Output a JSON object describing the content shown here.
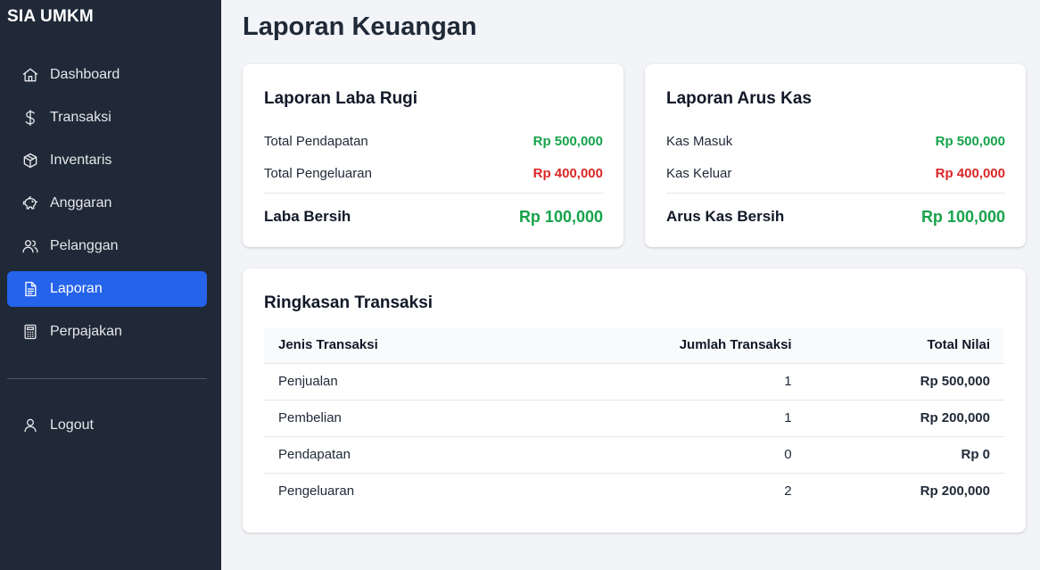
{
  "app": {
    "brand": "SIA UMKM"
  },
  "sidebar": {
    "items": [
      {
        "label": "Dashboard",
        "icon": "home-icon"
      },
      {
        "label": "Transaksi",
        "icon": "dollar-icon"
      },
      {
        "label": "Inventaris",
        "icon": "box-icon"
      },
      {
        "label": "Anggaran",
        "icon": "piggy-bank-icon"
      },
      {
        "label": "Pelanggan",
        "icon": "users-icon"
      },
      {
        "label": "Laporan",
        "icon": "document-icon",
        "active": true
      },
      {
        "label": "Perpajakan",
        "icon": "calculator-icon"
      }
    ],
    "logout": {
      "label": "Logout",
      "icon": "user-icon"
    }
  },
  "page": {
    "title": "Laporan Keuangan"
  },
  "profit_loss": {
    "title": "Laporan Laba Rugi",
    "income_label": "Total Pendapatan",
    "income_value": "Rp 500,000",
    "expense_label": "Total Pengeluaran",
    "expense_value": "Rp 400,000",
    "net_label": "Laba Bersih",
    "net_value": "Rp 100,000"
  },
  "cash_flow": {
    "title": "Laporan Arus Kas",
    "in_label": "Kas Masuk",
    "in_value": "Rp 500,000",
    "out_label": "Kas Keluar",
    "out_value": "Rp 400,000",
    "net_label": "Arus Kas Bersih",
    "net_value": "Rp 100,000"
  },
  "summary": {
    "title": "Ringkasan Transaksi",
    "columns": [
      "Jenis Transaksi",
      "Jumlah Transaksi",
      "Total Nilai"
    ],
    "rows": [
      [
        "Penjualan",
        "1",
        "Rp 500,000"
      ],
      [
        "Pembelian",
        "1",
        "Rp 200,000"
      ],
      [
        "Pendapatan",
        "0",
        "Rp 0"
      ],
      [
        "Pengeluaran",
        "2",
        "Rp 200,000"
      ]
    ]
  },
  "colors": {
    "sidebar_bg": "#1f2937",
    "active_item": "#2563eb",
    "positive": "#16a34a",
    "negative": "#dc2626",
    "page_bg": "#f2f4f7"
  }
}
